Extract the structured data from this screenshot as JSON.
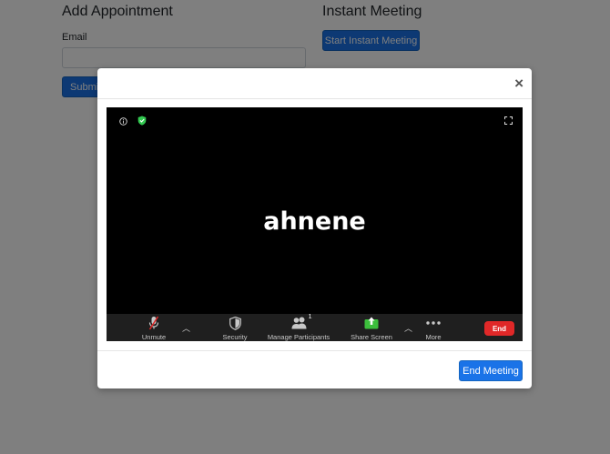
{
  "page": {
    "add_appointment": {
      "title": "Add Appointment",
      "email_label": "Email",
      "email_value": "",
      "submit_label": "Submit"
    },
    "instant_meeting": {
      "title": "Instant Meeting",
      "start_label": "Start Instant Meeting"
    }
  },
  "modal": {
    "close_glyph": "×",
    "participant_name": "ahnene",
    "toolbar": {
      "unmute_label": "Unmute",
      "security_label": "Security",
      "participants_label": "Manage Participants",
      "participants_count": "1",
      "share_label": "Share Screen",
      "more_label": "More",
      "end_label": "End"
    },
    "end_meeting_label": "End Meeting"
  },
  "colors": {
    "primary": "#1a73e8",
    "end_red": "#e02828",
    "share_green": "#3cbf3c",
    "secure_green": "#32c850"
  }
}
